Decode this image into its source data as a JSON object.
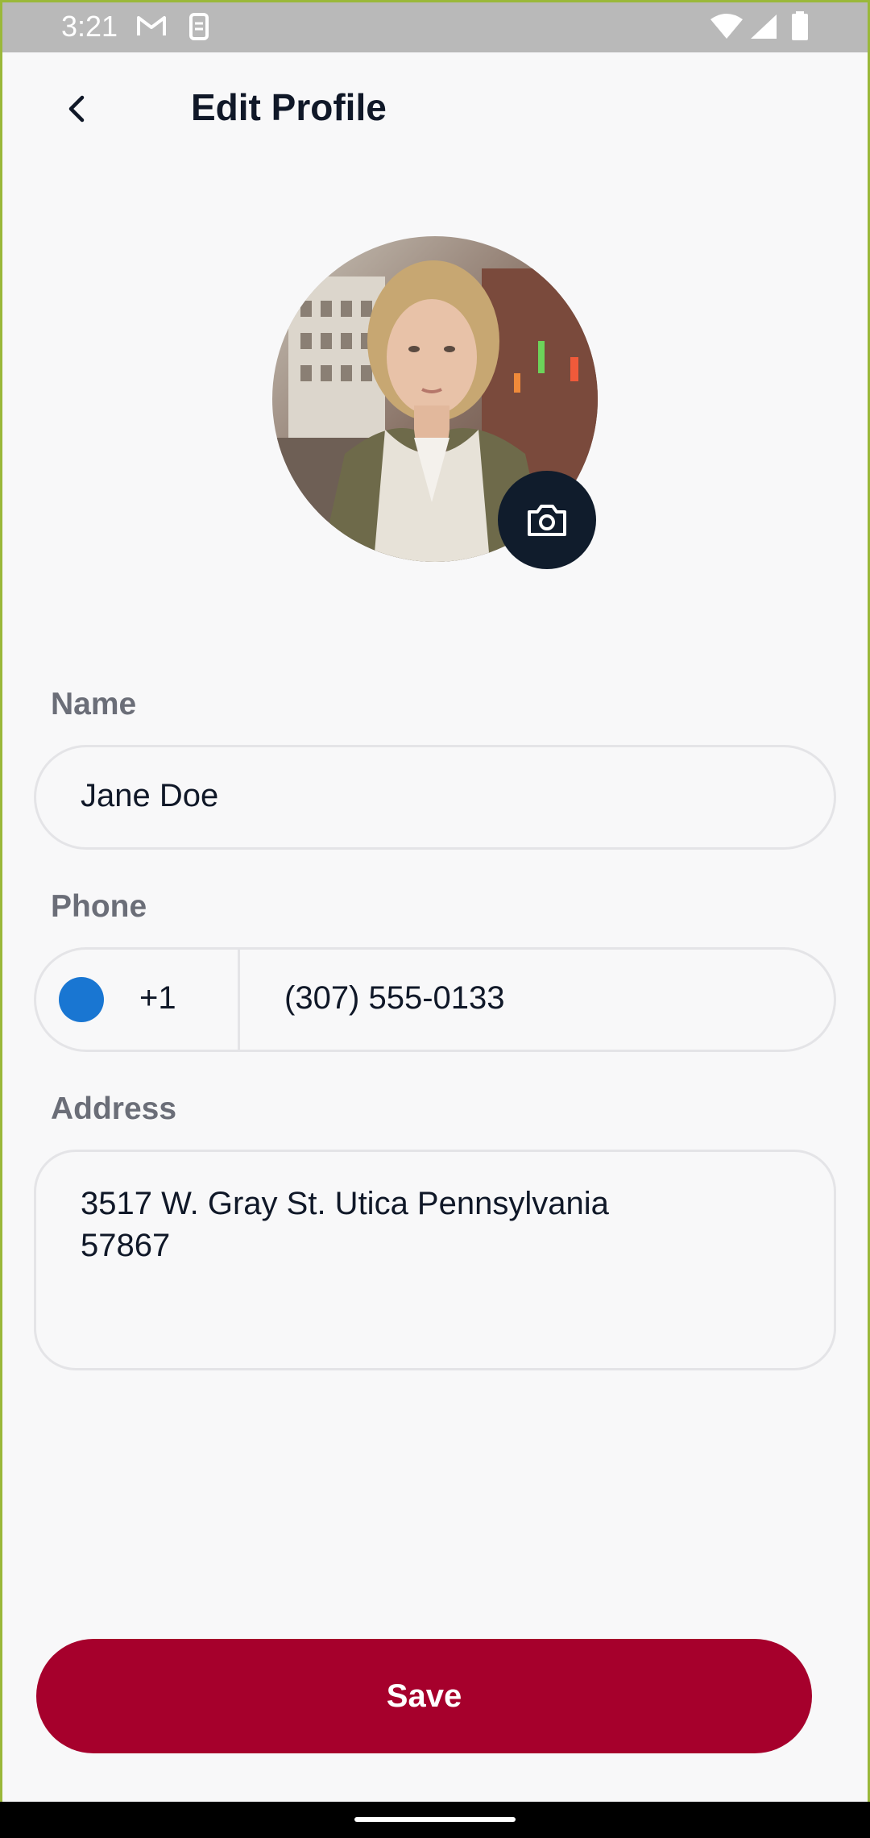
{
  "status_bar": {
    "time": "3:21",
    "icons": [
      "gmail-icon",
      "sim-icon",
      "wifi-icon",
      "signal-icon",
      "battery-icon"
    ]
  },
  "header": {
    "back_icon": "chevron-left-icon",
    "title": "Edit Profile"
  },
  "avatar": {
    "alt": "profile photo",
    "camera_icon": "camera-icon"
  },
  "form": {
    "name": {
      "label": "Name",
      "value": "Jane Doe"
    },
    "phone": {
      "label": "Phone",
      "dial_code": "+1",
      "value": "(307) 555-0133"
    },
    "address": {
      "label": "Address",
      "value": "3517 W. Gray St. Utica Pennsylvania\n57867"
    }
  },
  "actions": {
    "save_label": "Save"
  },
  "colors": {
    "primary": "#a6002c",
    "title": "#101828",
    "label": "#6b6e78",
    "border": "#e4e4e7",
    "background": "#f8f8f9",
    "flag": "#1976d2"
  }
}
